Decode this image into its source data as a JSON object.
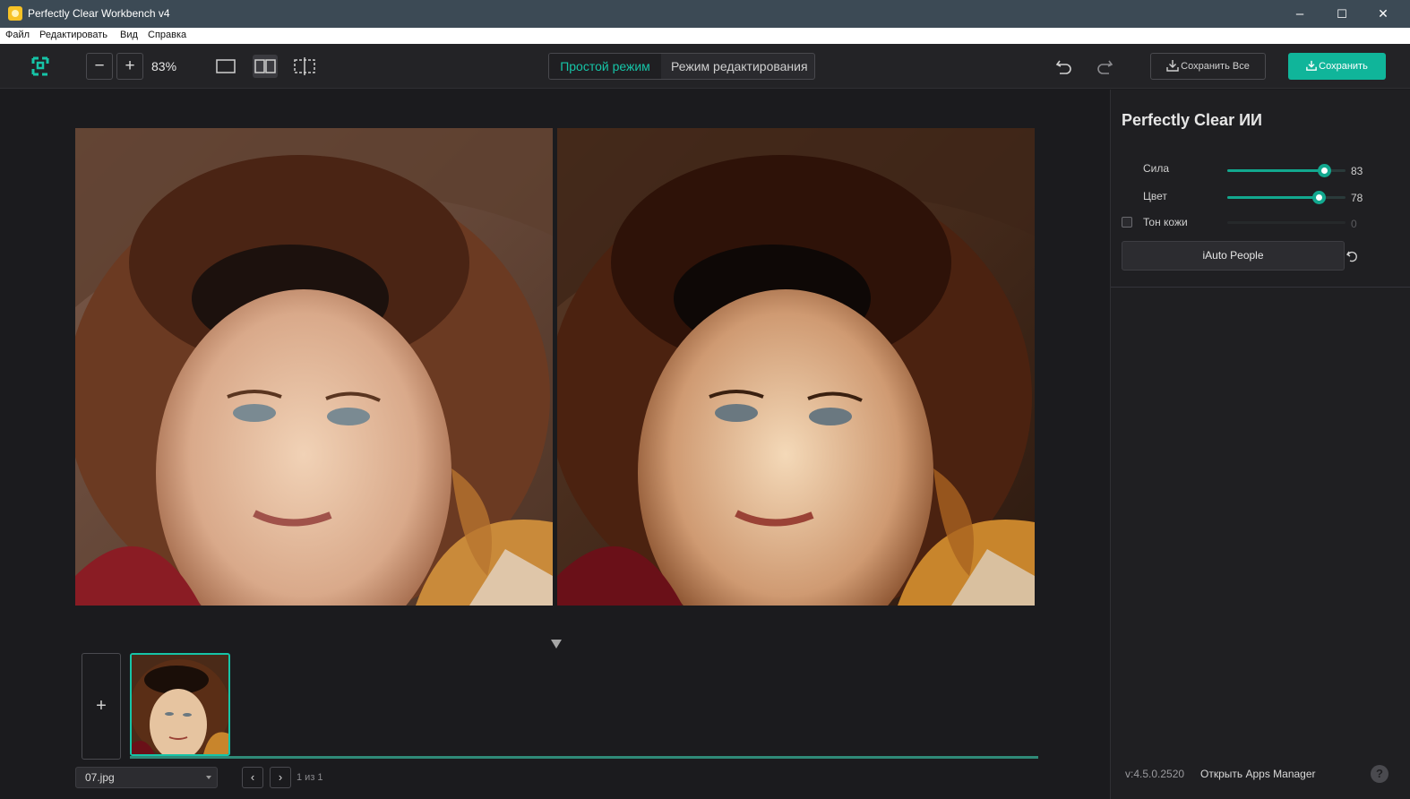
{
  "window": {
    "title": "Perfectly Clear Workbench v4",
    "minimize": "–",
    "maximize": "☐",
    "close": "✕"
  },
  "menu": [
    "Файл",
    "Редактировать",
    "Вид",
    "Справка"
  ],
  "toolbar": {
    "zoom_out": "−",
    "zoom_in": "+",
    "zoom_value": "83%",
    "mode_simple": "Простой режим",
    "mode_edit": "Режим редактирования",
    "save_all_label": "Сохранить Все",
    "save_label": "Сохранить",
    "active_view": "side-by-side"
  },
  "filmstrip": {
    "add_label": "+",
    "file_name": "07.jpg",
    "prev": "‹",
    "next": "›",
    "page_text": "1 из 1"
  },
  "panel": {
    "title": "Perfectly Clear ИИ",
    "sliders": [
      {
        "label": "Сила",
        "value": "83",
        "level": 0.83,
        "enabled": true
      },
      {
        "label": "Цвет",
        "value": "78",
        "level": 0.78,
        "enabled": true
      },
      {
        "label": "Тон кожи",
        "value": "0",
        "level": 0.0,
        "enabled": false
      }
    ],
    "preset_button": "iAuto People",
    "version": "v:4.5.0.2520",
    "apps_manager": "Открыть Apps Manager",
    "help": "?"
  },
  "colors": {
    "accent": "#16c4a7",
    "save_button": "#10b59a",
    "titlebar": "#3c4a55",
    "background": "#1b1b1e"
  },
  "icons": [
    "app-icon",
    "logo-icon",
    "single-view-icon",
    "side-by-side-view-icon",
    "split-view-icon",
    "undo-icon",
    "redo-icon",
    "download-icon",
    "reset-icon",
    "help-icon"
  ]
}
